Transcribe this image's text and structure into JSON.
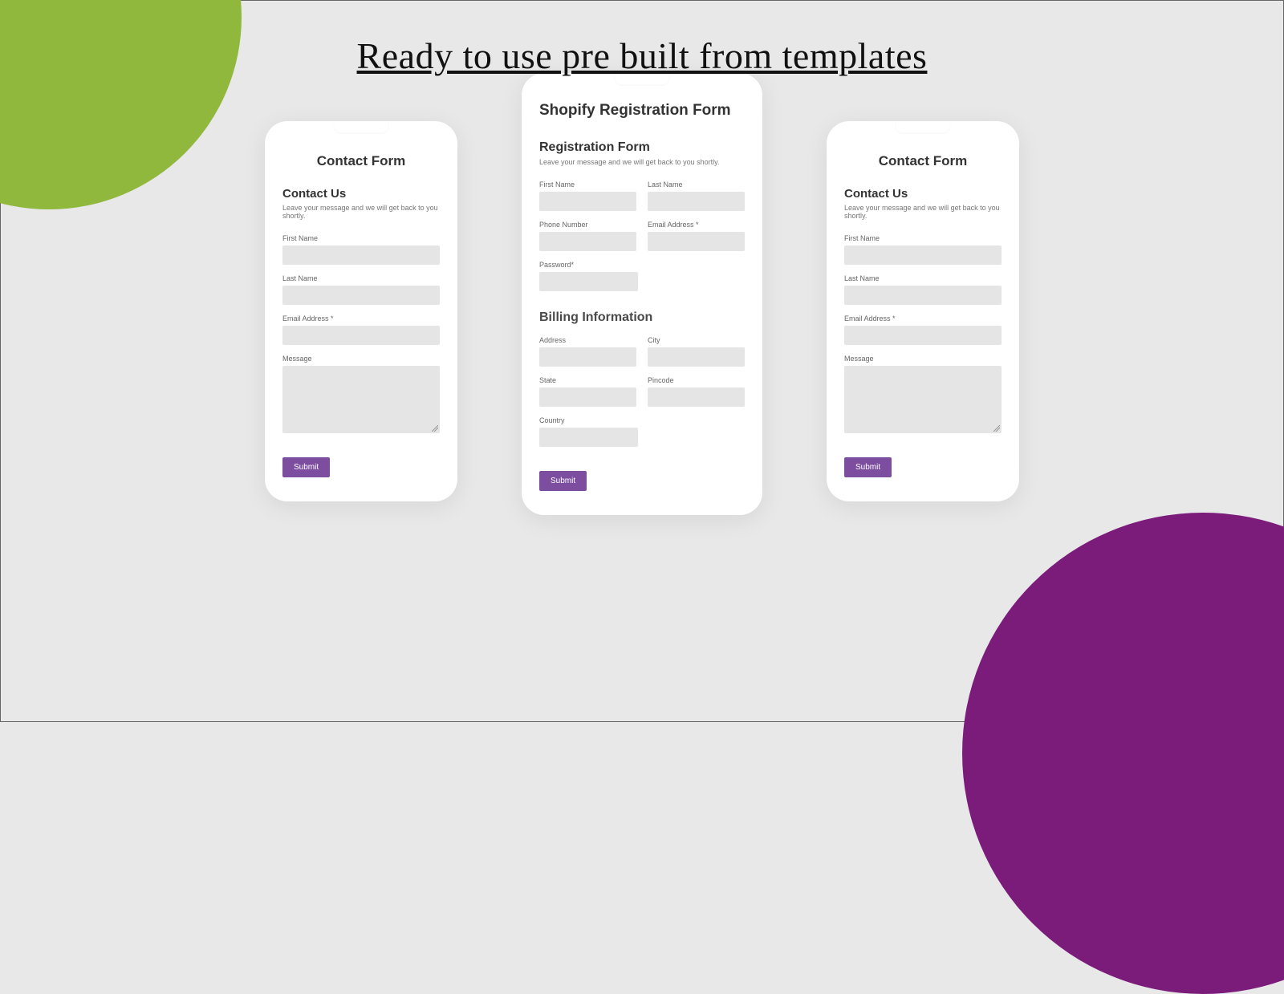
{
  "headline": "Ready to use pre built  from templates",
  "card1": {
    "title": "Contact Form",
    "section": "Contact Us",
    "sub": "Leave your message and we will get back to you shortly.",
    "f1": "First Name",
    "f2": "Last Name",
    "f3": "Email Address *",
    "f4": "Message",
    "submit": "Submit"
  },
  "card2": {
    "title": "Shopify Registration Form",
    "section": "Registration Form",
    "sub": "Leave your message and we will get back to you shortly.",
    "reg": {
      "fn": "First Name",
      "ln": "Last Name",
      "ph": "Phone Number",
      "em": "Email Address *",
      "pw": "Password*"
    },
    "billing_head": "Billing Information",
    "bill": {
      "addr": "Address",
      "city": "City",
      "state": "State",
      "pin": "Pincode",
      "country": "Country"
    },
    "submit": "Submit"
  },
  "card3": {
    "title": "Contact Form",
    "section": "Contact Us",
    "sub": "Leave your message and we will get back to you shortly.",
    "f1": "First Name",
    "f2": "Last Name",
    "f3": "Email Address *",
    "f4": "Message",
    "submit": "Submit"
  }
}
